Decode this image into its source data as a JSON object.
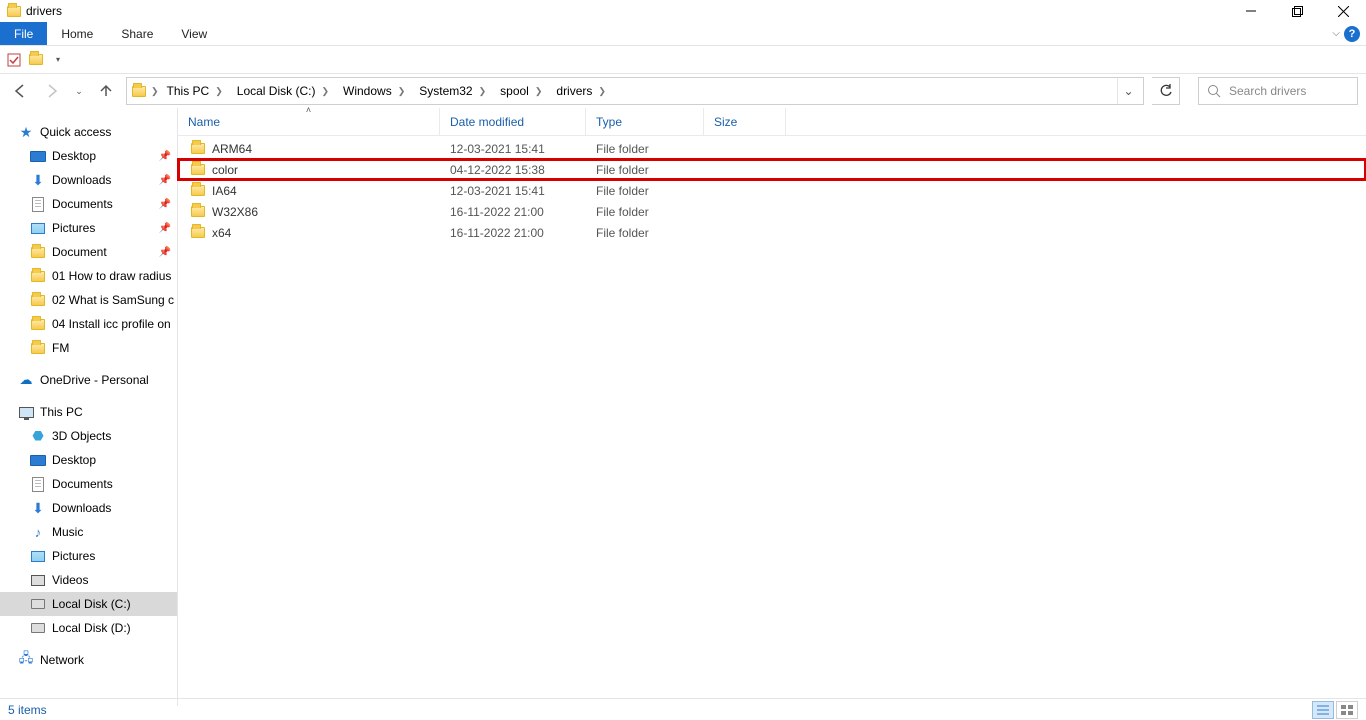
{
  "window": {
    "title": "drivers"
  },
  "ribbon": {
    "tabs": {
      "file": "File",
      "home": "Home",
      "share": "Share",
      "view": "View"
    }
  },
  "breadcrumb": {
    "c0": "This PC",
    "c1": "Local Disk (C:)",
    "c2": "Windows",
    "c3": "System32",
    "c4": "spool",
    "c5": "drivers"
  },
  "search": {
    "placeholder": "Search drivers"
  },
  "columns": {
    "name": "Name",
    "date": "Date modified",
    "type": "Type",
    "size": "Size"
  },
  "files": [
    {
      "name": "ARM64",
      "date": "12-03-2021 15:41",
      "type": "File folder",
      "size": ""
    },
    {
      "name": "color",
      "date": "04-12-2022 15:38",
      "type": "File folder",
      "size": ""
    },
    {
      "name": "IA64",
      "date": "12-03-2021 15:41",
      "type": "File folder",
      "size": ""
    },
    {
      "name": "W32X86",
      "date": "16-11-2022 21:00",
      "type": "File folder",
      "size": ""
    },
    {
      "name": "x64",
      "date": "16-11-2022 21:00",
      "type": "File folder",
      "size": ""
    }
  ],
  "highlight_index": 1,
  "tree": {
    "quick_access": "Quick access",
    "desktop": "Desktop",
    "downloads": "Downloads",
    "documents": "Documents",
    "pictures": "Pictures",
    "document": "Document",
    "f1": "01 How to draw radius",
    "f2": "02 What is SamSung c",
    "f3": "04 Install icc profile on",
    "f4": "FM",
    "onedrive": "OneDrive - Personal",
    "thispc": "This PC",
    "3d": "3D Objects",
    "desktop2": "Desktop",
    "documents2": "Documents",
    "downloads2": "Downloads",
    "music": "Music",
    "pictures2": "Pictures",
    "videos": "Videos",
    "diskc": "Local Disk (C:)",
    "diskd": "Local Disk (D:)",
    "network": "Network"
  },
  "status": {
    "items": "5 items"
  }
}
